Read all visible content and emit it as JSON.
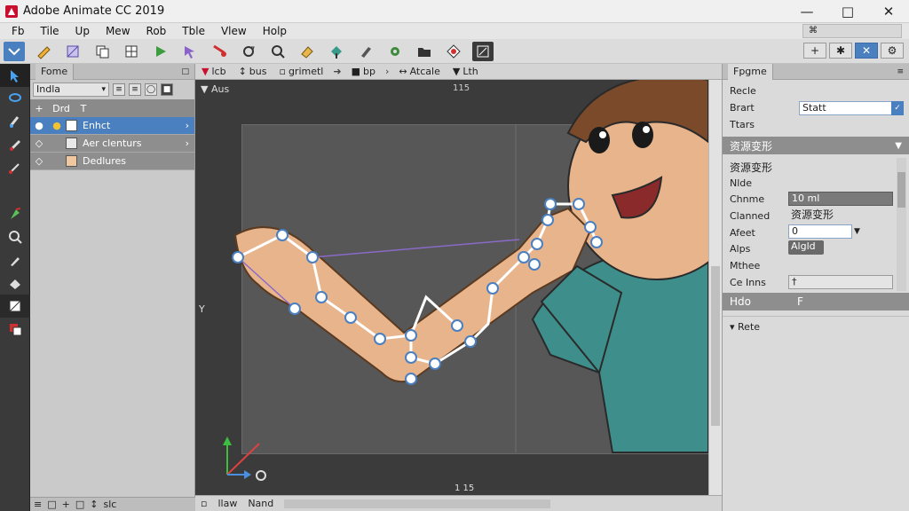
{
  "window": {
    "title": "Adobe Animate CC 2019"
  },
  "menu": [
    "Fb",
    "Tile",
    "Up",
    "Mew",
    "Rob",
    "Tble",
    "Vlew",
    "Holp"
  ],
  "workspace": "⌘",
  "layers_panel": {
    "tab": "Fome",
    "filter": "Indla",
    "header": [
      "+",
      "Drd",
      "T"
    ],
    "rows": [
      {
        "name": "Enhct",
        "selected": true
      },
      {
        "name": "Aer clenturs",
        "swatch": "#e8e8e8"
      },
      {
        "name": "Dedlures",
        "swatch": "#f0c8a0"
      }
    ],
    "footer": [
      "≡",
      "□",
      "+",
      "□",
      "↕",
      "slc"
    ]
  },
  "stage": {
    "tabs": [
      {
        "label": "lcb"
      },
      {
        "label": "bus"
      },
      {
        "label": "grimetl"
      },
      {
        "label": "bp"
      },
      {
        "label": "Atcale"
      },
      {
        "label": "Lth"
      }
    ],
    "header": "Aus",
    "frame_top": "115",
    "frame_bottom": "1 15",
    "left_marker": "Y",
    "bottom": [
      "llaw",
      "Nand"
    ]
  },
  "props": {
    "tab": "Fpgme",
    "r_label": "Recle",
    "start_label": "Brart",
    "start_value": "Statt",
    "type_label": "Ttars",
    "section": "资源变形",
    "sub_title": "资源变形",
    "node_label": "Nlde",
    "channel_label": "Chnme",
    "channel_value": "10 ml",
    "clamped_label": "Clanned",
    "clamped_value": "资源变形",
    "affect_label": "Afeet",
    "affect_value": "0",
    "alpha_label": "Alps",
    "alpha_value": "Algld",
    "method_label": "Mthee",
    "ce_label": "Ce Inns",
    "ce_value": "†",
    "hide_label": "Hdo",
    "hide_value": "F",
    "rete_label": "Rete"
  }
}
